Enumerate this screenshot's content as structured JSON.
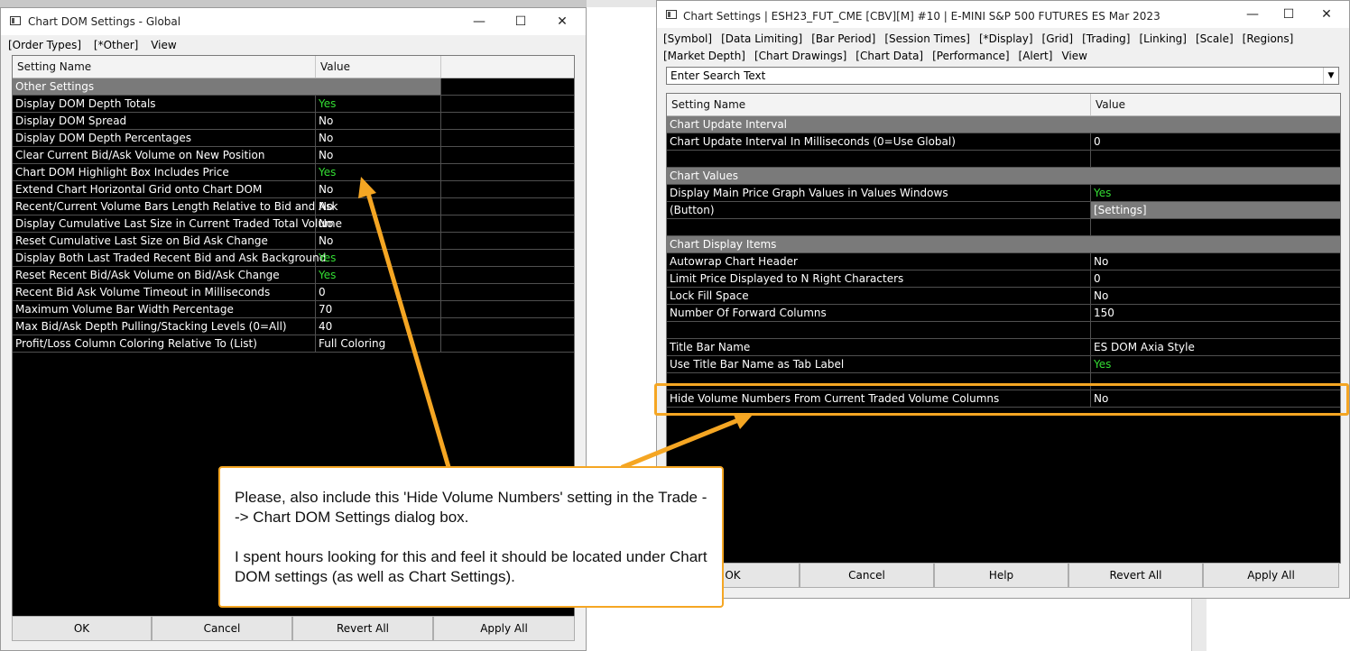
{
  "left_window": {
    "title": "Chart DOM Settings - Global",
    "menu": [
      "[Order Types]",
      "[*Other]",
      "View"
    ],
    "headers": {
      "name": "Setting Name",
      "value": "Value"
    },
    "section": "Other Settings",
    "rows": [
      {
        "name": "Display DOM Depth Totals",
        "value": "Yes"
      },
      {
        "name": "Display DOM Spread",
        "value": "No"
      },
      {
        "name": "Display DOM Depth Percentages",
        "value": "No"
      },
      {
        "name": "Clear Current Bid/Ask Volume on New Position",
        "value": "No"
      },
      {
        "name": "Chart DOM Highlight Box Includes Price",
        "value": "Yes"
      },
      {
        "name": "Extend Chart Horizontal Grid onto Chart DOM",
        "value": "No"
      },
      {
        "name": "Recent/Current Volume Bars Length Relative to Bid and Ask",
        "value": "No"
      },
      {
        "name": "Display Cumulative Last Size in Current Traded Total Volume",
        "value": "No"
      },
      {
        "name": "Reset Cumulative Last Size on Bid Ask Change",
        "value": "No"
      },
      {
        "name": "Display Both Last Traded Recent Bid and Ask Background",
        "value": "Yes"
      },
      {
        "name": "Reset Recent Bid/Ask Volume on Bid/Ask Change",
        "value": "Yes"
      },
      {
        "name": "Recent Bid Ask Volume Timeout in Milliseconds",
        "value": "0"
      },
      {
        "name": "Maximum Volume Bar Width Percentage",
        "value": "70"
      },
      {
        "name": "Max Bid/Ask Depth Pulling/Stacking Levels (0=All)",
        "value": "40"
      },
      {
        "name": "Profit/Loss Column Coloring Relative To (List)",
        "value": "Full Coloring"
      }
    ],
    "buttons": [
      "OK",
      "Cancel",
      "Revert All",
      "Apply All"
    ]
  },
  "right_window": {
    "title": "Chart Settings | ESH23_FUT_CME [CBV][M]  #10 | E-MINI S&P 500 FUTURES ES Mar 2023",
    "menu_line1": [
      "[Symbol]",
      "[Data Limiting]",
      "[Bar Period]",
      "[Session Times]",
      "[*Display]",
      "[Grid]",
      "[Trading]",
      "[Linking]",
      "[Scale]",
      "[Regions]"
    ],
    "menu_line2": [
      "[Market Depth]",
      "[Chart Drawings]",
      "[Chart Data]",
      "[Performance]",
      "[Alert]",
      "View"
    ],
    "search_placeholder": "Enter Search Text",
    "headers": {
      "name": "Setting Name",
      "value": "Value"
    },
    "rows": [
      {
        "type": "section",
        "name": "Chart Update Interval",
        "value": ""
      },
      {
        "type": "row",
        "name": "Chart Update Interval In Milliseconds (0=Use Global)",
        "value": "0"
      },
      {
        "type": "blank",
        "name": "",
        "value": ""
      },
      {
        "type": "section",
        "name": "Chart Values",
        "value": ""
      },
      {
        "type": "row",
        "name": "Display Main Price Graph Values in Values Windows",
        "value": "Yes"
      },
      {
        "type": "button",
        "name": " (Button)",
        "value": "[Settings]"
      },
      {
        "type": "blank",
        "name": "",
        "value": ""
      },
      {
        "type": "section",
        "name": "Chart Display Items",
        "value": ""
      },
      {
        "type": "row",
        "name": "Autowrap Chart Header",
        "value": "No"
      },
      {
        "type": "row",
        "name": "Limit Price Displayed to N Right Characters",
        "value": "0"
      },
      {
        "type": "row",
        "name": "Lock Fill Space",
        "value": "No"
      },
      {
        "type": "row",
        "name": "Number Of Forward Columns",
        "value": "150"
      },
      {
        "type": "blank",
        "name": "",
        "value": ""
      },
      {
        "type": "row",
        "name": "Title Bar Name",
        "value": "ES DOM Axia Style"
      },
      {
        "type": "row",
        "name": "Use Title Bar Name as Tab Label",
        "value": "Yes"
      },
      {
        "type": "blank",
        "name": "",
        "value": ""
      },
      {
        "type": "row",
        "name": "Hide Volume Numbers From Current Traded Volume Columns",
        "value": "No"
      }
    ],
    "buttons": [
      "OK",
      "Cancel",
      "Help",
      "Revert All",
      "Apply All"
    ]
  },
  "callout": {
    "paragraph1": "Please, also include this 'Hide Volume Numbers' setting in the Trade --> Chart DOM Settings dialog box.",
    "paragraph2": "I spent hours looking for this and feel it should be located under Chart DOM settings (as well as Chart Settings)."
  },
  "colors": {
    "accent": "#f5a623",
    "yes": "#33dd33",
    "grid_bg": "#000000",
    "section_bg": "#7a7a7a"
  }
}
